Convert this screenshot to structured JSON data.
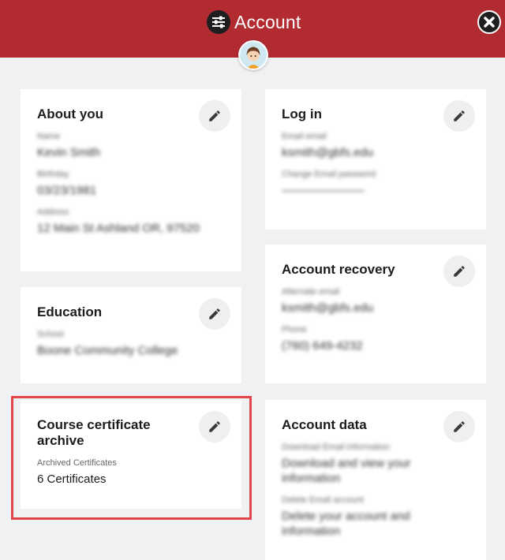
{
  "header": {
    "title": "Account",
    "accent_color": "#b12b31",
    "settings_icon": "sliders-icon",
    "close_icon": "close-icon"
  },
  "about": {
    "title": "About you",
    "fields": [
      {
        "label": "Name",
        "value": "Kevin Smith"
      },
      {
        "label": "Birthday",
        "value": "03/23/1981"
      },
      {
        "label": "Address",
        "value": "12 Main St Ashland OR, 97520"
      }
    ]
  },
  "login": {
    "title": "Log in",
    "fields": [
      {
        "label": "Email email",
        "value": "ksmith@gbfs.edu"
      },
      {
        "label": "Change Email password",
        "value": "———————"
      }
    ]
  },
  "education": {
    "title": "Education",
    "fields": [
      {
        "label": "School",
        "value": "Boone Community College"
      }
    ]
  },
  "recovery": {
    "title": "Account recovery",
    "fields": [
      {
        "label": "Alternate email",
        "value": "ksmith@gbfs.edu"
      },
      {
        "label": "Phone",
        "value": "(760) 649-4232"
      }
    ]
  },
  "certificates": {
    "title": "Course certificate archive",
    "fields": [
      {
        "label": "Archived Certificates",
        "value": "6 Certificates"
      }
    ]
  },
  "data": {
    "title": "Account data",
    "fields": [
      {
        "label": "Download Email information",
        "value": "Download and view your information"
      },
      {
        "label": "Delete Email account",
        "value": "Delete your account and information"
      }
    ]
  }
}
